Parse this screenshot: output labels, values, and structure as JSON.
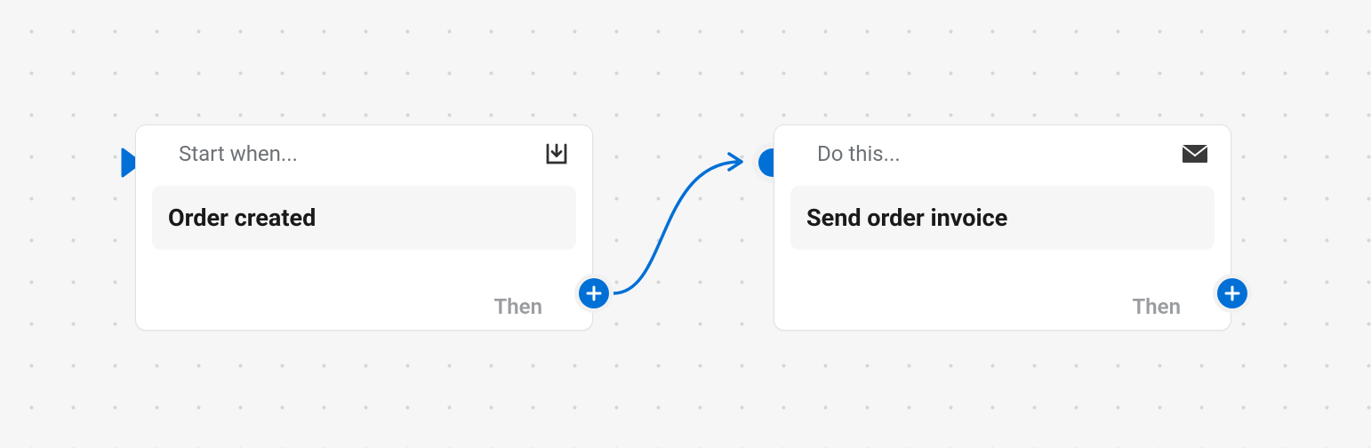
{
  "nodes": {
    "trigger": {
      "header_label": "Start when...",
      "chip_text": "Order created",
      "then_label": "Then",
      "icon": "inbox-download"
    },
    "action": {
      "header_label": "Do this...",
      "chip_text": "Send order invoice",
      "then_label": "Then",
      "icon": "email"
    }
  },
  "colors": {
    "accent": "#006fd6",
    "text_muted": "#6d7175",
    "text_dark": "#1a1a1a"
  }
}
